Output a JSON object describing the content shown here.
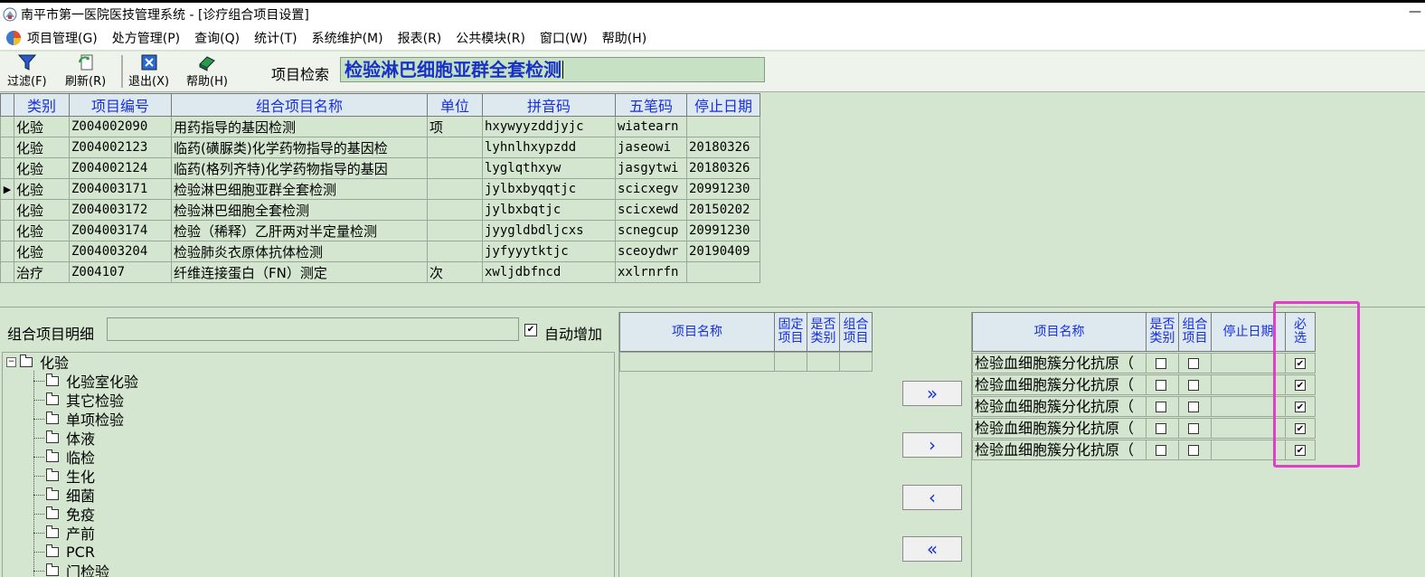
{
  "window": {
    "title": "南平市第一医院医技管理系统 - [诊疗组合项目设置]",
    "min_symbol": "—"
  },
  "menu": [
    "项目管理(G)",
    "处方管理(P)",
    "查询(Q)",
    "统计(T)",
    "系统维护(M)",
    "报表(R)",
    "公共模块(R)",
    "窗口(W)",
    "帮助(H)"
  ],
  "toolbar": {
    "filter": "过滤(F)",
    "refresh": "刷新(R)",
    "exit": "退出(X)",
    "help": "帮助(H)",
    "search_label": "项目检索",
    "search_value": "检验淋巴细胞亚群全套检测"
  },
  "grid": {
    "columns": [
      "类别",
      "项目编号",
      "组合项目名称",
      "单位",
      "拼音码",
      "五笔码",
      "停止日期"
    ],
    "rows": [
      [
        "化验",
        "Z004002090",
        "用药指导的基因检测",
        "项",
        "hxywyyzddjyjc",
        "wiatearn",
        ""
      ],
      [
        "化验",
        "Z004002123",
        "临药(磺脲类)化学药物指导的基因检",
        "",
        "lyhnlhxypzdd",
        "jaseowi",
        "20180326"
      ],
      [
        "化验",
        "Z004002124",
        "临药(格列齐特)化学药物指导的基因",
        "",
        "lyglqthxyw",
        "jasgytwi",
        "20180326"
      ],
      [
        "化验",
        "Z004003171",
        "检验淋巴细胞亚群全套检测",
        "",
        "jylbxbyqqtjc",
        "scicxegv",
        "20991230"
      ],
      [
        "化验",
        "Z004003172",
        "检验淋巴细胞全套检测",
        "",
        "jylbxbqtjc",
        "scicxewd",
        "20150202"
      ],
      [
        "化验",
        "Z004003174",
        "检验（稀释）乙肝两对半定量检测",
        "",
        "jyygldbdljcxs",
        "scnegcup",
        "20991230"
      ],
      [
        "化验",
        "Z004003204",
        "检验肺炎衣原体抗体检测",
        "",
        "jyfyyytktjc",
        "sceoydwr",
        "20190409"
      ],
      [
        "治疗",
        "Z004107",
        "纤维连接蛋白（FN）测定",
        "次",
        "xwljdbfncd",
        "xxlrnrfn",
        ""
      ]
    ],
    "current_row": 3
  },
  "detail": {
    "label": "组合项目明细",
    "auto_add_label": "自动增加",
    "auto_add_checked": true
  },
  "tree": {
    "root": "化验",
    "children": [
      "化验室化验",
      "其它检验",
      "单项检验",
      "体液",
      "临检",
      "生化",
      "细菌",
      "免疫",
      "产前",
      "PCR",
      "门检验"
    ]
  },
  "middle_table": {
    "columns": [
      "项目名称",
      "固定项目",
      "是否类别",
      "组合项目"
    ]
  },
  "arrows": [
    "»",
    "›",
    "‹",
    "«"
  ],
  "right_table": {
    "columns": [
      "项目名称",
      "是否类别",
      "组合项目",
      "停止日期",
      "必选"
    ],
    "rows": [
      {
        "name": "检验血细胞簇分化抗原（",
        "is_category": false,
        "is_group": false,
        "stop_date": "",
        "required": true
      },
      {
        "name": "检验血细胞簇分化抗原（",
        "is_category": false,
        "is_group": false,
        "stop_date": "",
        "required": true
      },
      {
        "name": "检验血细胞簇分化抗原（",
        "is_category": false,
        "is_group": false,
        "stop_date": "",
        "required": true
      },
      {
        "name": "检验血细胞簇分化抗原（",
        "is_category": false,
        "is_group": false,
        "stop_date": "",
        "required": true
      },
      {
        "name": "检验血细胞簇分化抗原（",
        "is_category": false,
        "is_group": false,
        "stop_date": "",
        "required": true
      }
    ]
  },
  "colors": {
    "panel_bg": "#d4e6d0",
    "header_text": "#1730e0",
    "search_text": "#1730c8",
    "highlight": "#e040c8"
  }
}
